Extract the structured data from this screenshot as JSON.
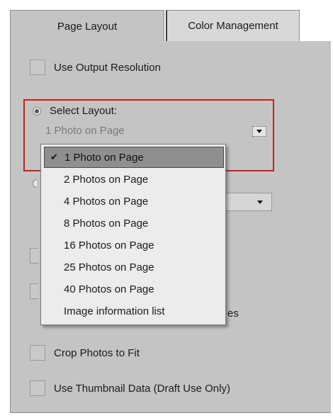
{
  "tabs": [
    {
      "label": "Page Layout",
      "active": true
    },
    {
      "label": "Color Management",
      "active": false
    }
  ],
  "options": {
    "use_output_resolution": {
      "label": "Use Output Resolution",
      "checked": false
    },
    "select_layout": {
      "label": "Select Layout:",
      "selected": true
    },
    "layout_select": {
      "value": "1 Photo on Page"
    },
    "crop_photos": {
      "label": "Crop Photos to Fit",
      "checked": false
    },
    "thumbnail_data": {
      "label": "Use Thumbnail Data (Draft Use Only)",
      "checked": false
    },
    "obscured_label_tail": "es"
  },
  "dropdown": {
    "items": [
      {
        "label": "1 Photo on Page",
        "selected": true
      },
      {
        "label": "2 Photos on Page",
        "selected": false
      },
      {
        "label": "4 Photos on Page",
        "selected": false
      },
      {
        "label": "8 Photos on Page",
        "selected": false
      },
      {
        "label": "16 Photos on Page",
        "selected": false
      },
      {
        "label": "25 Photos on Page",
        "selected": false
      },
      {
        "label": "40 Photos on Page",
        "selected": false
      },
      {
        "label": "Image information list",
        "selected": false
      }
    ],
    "check_glyph": "✔"
  },
  "colors": {
    "panel_bg": "#c4c4c4",
    "highlight_border": "#d01c1c",
    "menu_selected_bg": "#8f8f8f"
  }
}
